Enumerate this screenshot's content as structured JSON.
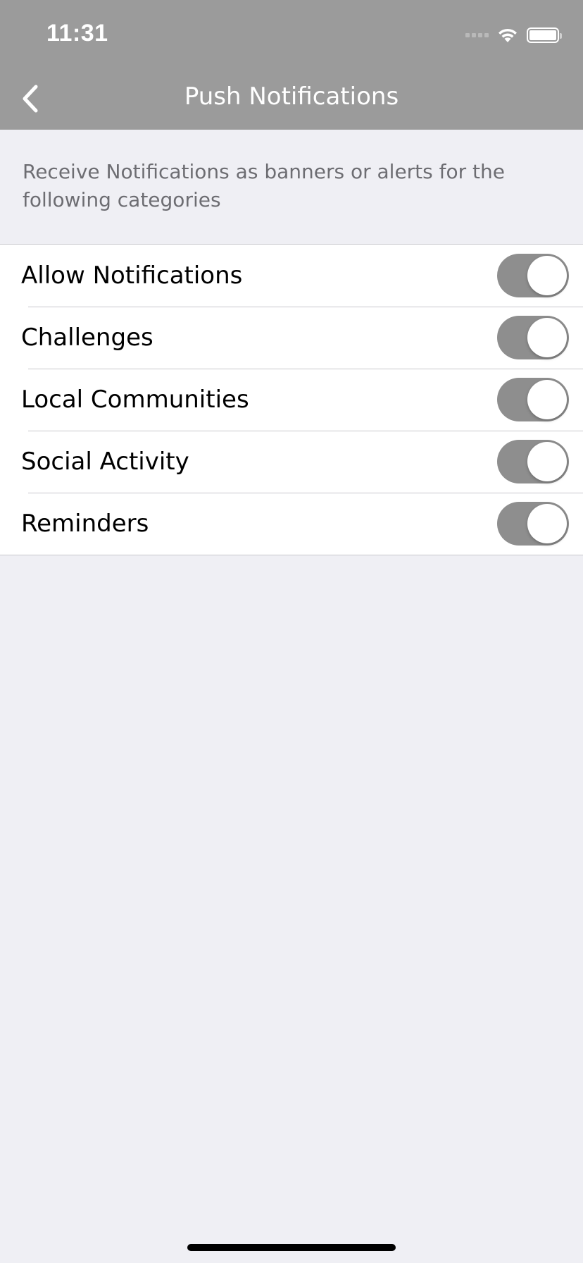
{
  "status_bar": {
    "time": "11:31",
    "icons": [
      "cellular-signal-icon",
      "wifi-icon",
      "battery-icon"
    ]
  },
  "nav": {
    "title": "Push Notifications",
    "back_icon": "chevron-left-icon"
  },
  "description": "Receive Notifications as banners or alerts for the following categories",
  "settings": [
    {
      "label": "Allow Notifications",
      "enabled": true
    },
    {
      "label": "Challenges",
      "enabled": true
    },
    {
      "label": "Local Communities",
      "enabled": true
    },
    {
      "label": "Social Activity",
      "enabled": true
    },
    {
      "label": "Reminders",
      "enabled": true
    }
  ],
  "colors": {
    "header_bg": "#9b9b9b",
    "page_bg": "#efeff4",
    "toggle_on": "#8e8e8e"
  }
}
